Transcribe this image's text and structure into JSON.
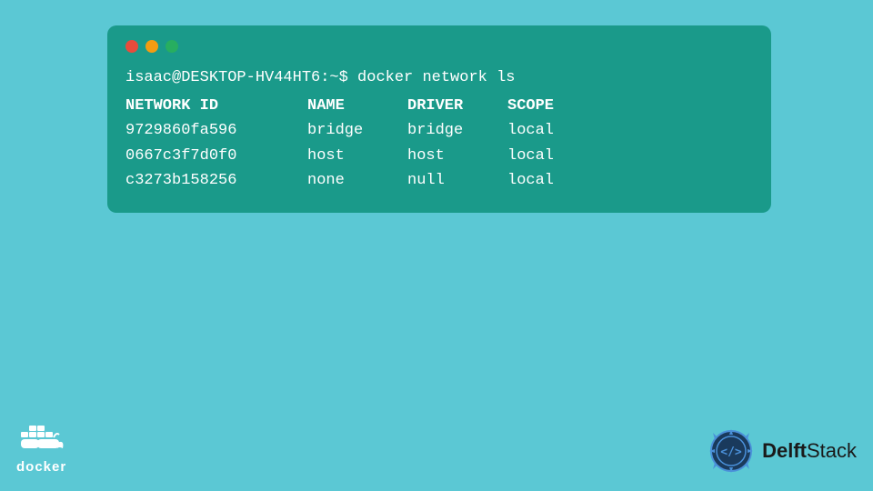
{
  "background_color": "#5BC8D4",
  "terminal": {
    "bg_color": "#1A9A8A",
    "command_line": "isaac@DESKTOP-HV44HT6:~$ docker network ls",
    "header": {
      "network_id": "NETWORK ID",
      "name": "NAME",
      "driver": "DRIVER",
      "scope": "SCOPE"
    },
    "rows": [
      {
        "id": "9729860fa596",
        "name": "bridge",
        "driver": "bridge",
        "scope": "local"
      },
      {
        "id": "0667c3f7d0f0",
        "name": "host",
        "driver": "host",
        "scope": "local"
      },
      {
        "id": "c3273b158256",
        "name": "none",
        "driver": "null",
        "scope": "local"
      }
    ],
    "dots": [
      "red",
      "yellow",
      "green"
    ]
  },
  "docker_label": "docker",
  "delftstack_label_bold": "Delft",
  "delftstack_label_regular": "Stack"
}
